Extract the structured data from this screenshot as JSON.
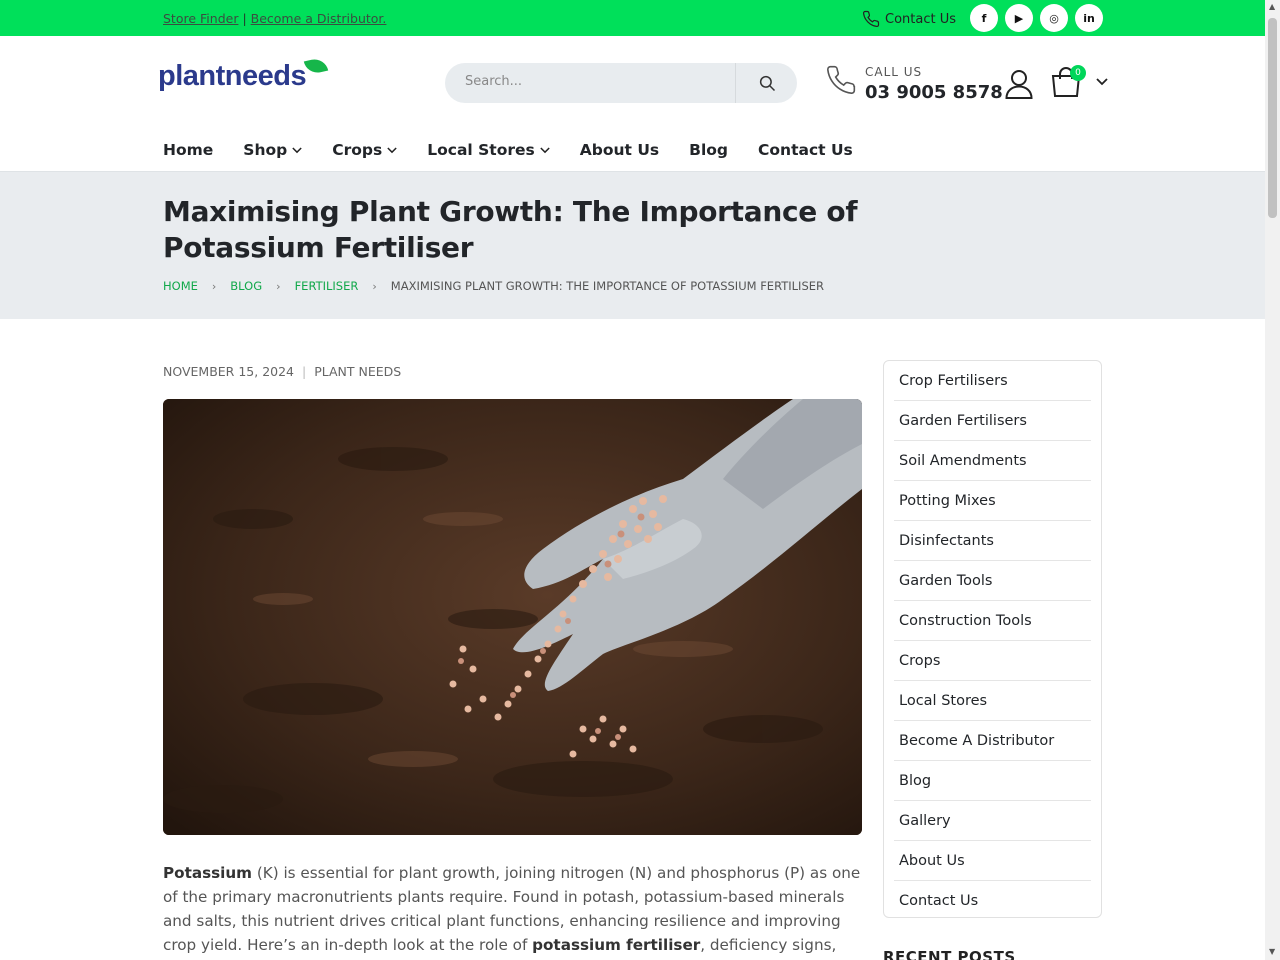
{
  "topbar": {
    "store_finder": "Store Finder",
    "separator": "|",
    "become_distributor": "Become a Distributor.",
    "contact_label": "Contact Us",
    "social": [
      "f",
      "▶",
      "◎",
      "in"
    ]
  },
  "header": {
    "logo_text": "plantneeds",
    "search_placeholder": "Search...",
    "call_label": "CALL US",
    "phone": "03 9005 8578",
    "cart_count": "0"
  },
  "nav": {
    "items": [
      {
        "label": "Home"
      },
      {
        "label": "Shop"
      },
      {
        "label": "Crops"
      },
      {
        "label": "Local Stores"
      },
      {
        "label": "About Us"
      },
      {
        "label": "Blog"
      },
      {
        "label": "Contact Us"
      }
    ]
  },
  "hero": {
    "title": "Maximising Plant Growth: The Importance of Potassium Fertiliser",
    "breadcrumb": [
      "HOME",
      "BLOG",
      "FERTILISER",
      "MAXIMISING PLANT GROWTH: THE IMPORTANCE OF POTASSIUM FERTILISER"
    ]
  },
  "post": {
    "date": "NOVEMBER 15, 2024",
    "meta_sep": "|",
    "author": "PLANT NEEDS",
    "p1_bold1": "Potassium",
    "p1_a": " (K) is essential for plant growth, joining nitrogen (N) and phosphorus (P) as one of the primary macronutrients plants require. Found in potash, potassium-based minerals and salts, this nutrient drives critical plant functions, enhancing resilience and improving crop yield. Here’s an in-depth look at the role of ",
    "p1_bold2": "potassium fertiliser",
    "p1_b": ", deficiency signs, types"
  },
  "sidebar": {
    "items": [
      "Crop Fertilisers",
      "Garden Fertilisers",
      "Soil Amendments",
      "Potting Mixes",
      "Disinfectants",
      "Garden Tools",
      "Construction Tools",
      "Crops",
      "Local Stores",
      "Become A Distributor",
      "Blog",
      "Gallery",
      "About Us",
      "Contact Us"
    ],
    "recent_heading": "RECENT POSTS"
  },
  "colors": {
    "accent": "#00e05a",
    "link_green": "#11a84a",
    "hero_bg": "#e9ecef",
    "logo_blue": "#2b3a8c"
  }
}
